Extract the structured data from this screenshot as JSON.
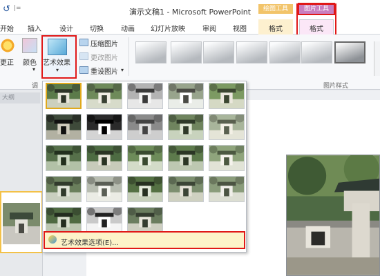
{
  "window": {
    "title": "演示文稿1 - Microsoft PowerPoint"
  },
  "quick_access": {
    "undo_icon": "undo-icon",
    "separator": "|="
  },
  "context_tabs": {
    "drawing_tools": "绘图工具",
    "picture_tools": "图片工具"
  },
  "tabs": [
    {
      "label": "开始"
    },
    {
      "label": "插入"
    },
    {
      "label": "设计"
    },
    {
      "label": "切换"
    },
    {
      "label": "动画"
    },
    {
      "label": "幻灯片放映"
    },
    {
      "label": "审阅"
    },
    {
      "label": "视图"
    },
    {
      "label": "格式"
    },
    {
      "label": "格式"
    }
  ],
  "ribbon": {
    "correct_label": "更正",
    "color_label": "颜色",
    "artistic_effects_label": "艺术效果",
    "compress_label": "压缩图片",
    "change_picture_label": "更改图片",
    "reset_picture_label": "重设图片",
    "adjust_group_label": "调",
    "picture_styles_label": "图片样式",
    "more_glyph": "▾"
  },
  "left_pane": {
    "outline_tab": "大纲"
  },
  "artistic_dropdown": {
    "options_label": "艺术效果选项(E)...",
    "selected_index": 0,
    "effect_count": 23
  },
  "colors": {
    "highlight_red": "#e01818",
    "drawing_tools_accent": "#f2c46a",
    "picture_tools_accent": "#c97fbf",
    "selection_gold": "#e0a91c"
  }
}
